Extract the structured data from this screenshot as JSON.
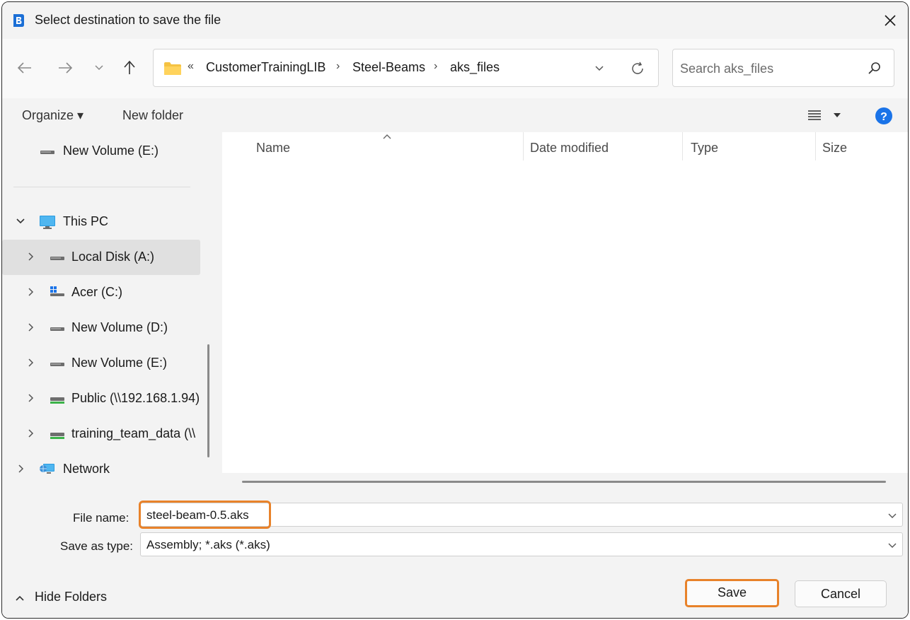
{
  "window": {
    "title": "Select destination to save the file",
    "close_glyph": "✕"
  },
  "nav": {
    "back_glyph": "←",
    "forward_glyph": "→",
    "recent_glyph": "⌄",
    "up_glyph": "↑",
    "overflow_glyph": "«",
    "breadcrumbs": [
      "CustomerTrainingLIB",
      "Steel-Beams",
      "aks_files"
    ],
    "separator_glyph": "›"
  },
  "search": {
    "placeholder": "Search aks_files"
  },
  "commands": {
    "organize": "Organize ▾",
    "new_folder": "New folder"
  },
  "nav_pane": {
    "items": [
      {
        "label": "New Volume (E:)",
        "icon": "drive-icon"
      },
      {
        "label": "This PC",
        "icon": "computer-icon",
        "expanded": true
      },
      {
        "label": "Local Disk (A:)",
        "icon": "drive-icon",
        "selected": true
      },
      {
        "label": "Acer (C:)",
        "icon": "windows-drive-icon"
      },
      {
        "label": "New Volume (D:)",
        "icon": "drive-icon"
      },
      {
        "label": "New Volume (E:)",
        "icon": "drive-icon"
      },
      {
        "label": "Public (\\\\192.168.1.94)",
        "icon": "network-drive-icon"
      },
      {
        "label": "training_team_data (\\\\",
        "icon": "network-drive-icon"
      },
      {
        "label": "Network",
        "icon": "network-icon"
      }
    ]
  },
  "columns": [
    "Name",
    "Date modified",
    "Type",
    "Size"
  ],
  "fields": {
    "file_name_label": "File name:",
    "file_name_value": "steel-beam-0.5.aks",
    "save_type_label": "Save as type:",
    "save_type_value": "Assembly; *.aks (*.aks)"
  },
  "footer": {
    "hide_folders": "Hide Folders",
    "save": "Save",
    "cancel": "Cancel"
  },
  "colors": {
    "accent_highlight": "#e8822a",
    "help_blue": "#1a73e8",
    "app_icon_blue": "#1b6fd6",
    "folder_yellow": "#f5c242"
  }
}
